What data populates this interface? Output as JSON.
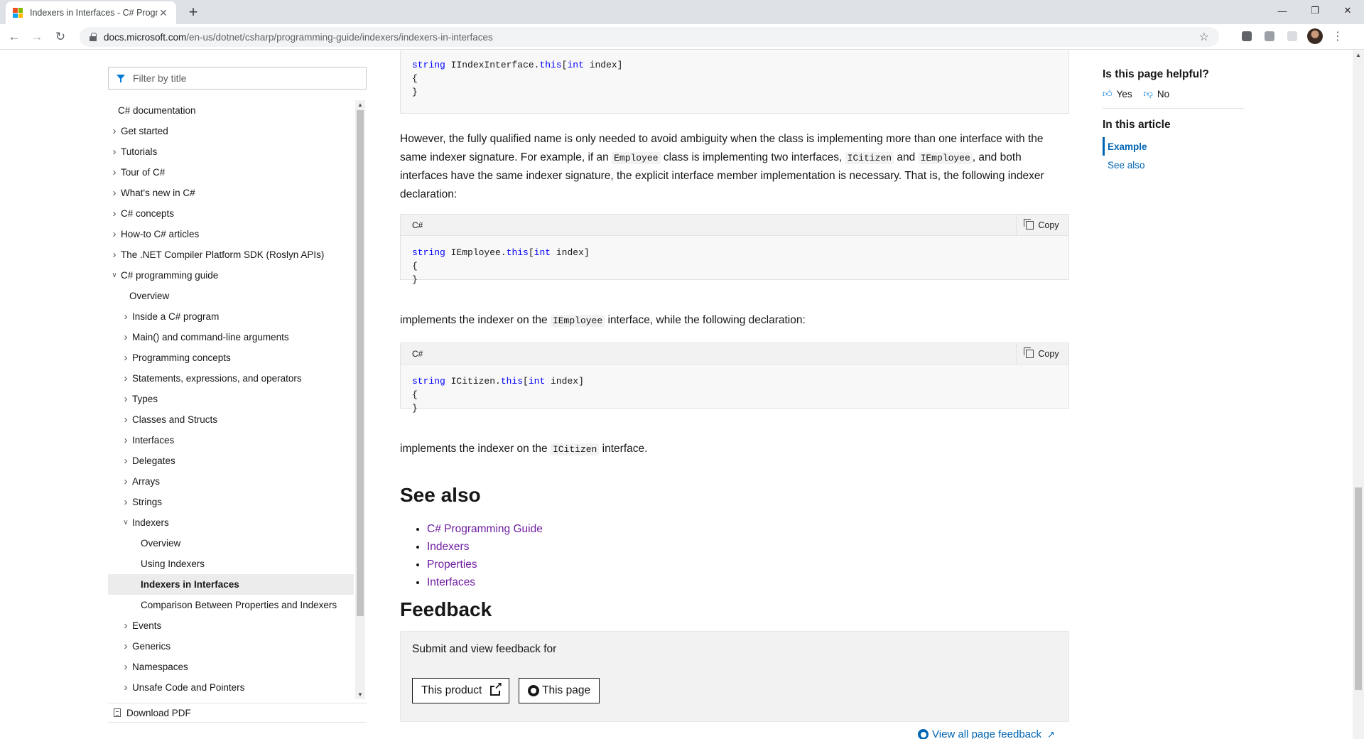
{
  "browser": {
    "tab_title": "Indexers in Interfaces - C# Progra",
    "url_host": "docs.microsoft.com",
    "url_path": "/en-us/dotnet/csharp/programming-guide/indexers/indexers-in-interfaces"
  },
  "toc": {
    "filter_placeholder": "Filter by title",
    "items": [
      {
        "label": "C# documentation",
        "level": 0,
        "chevron": "none"
      },
      {
        "label": "Get started",
        "level": 0,
        "chevron": "right"
      },
      {
        "label": "Tutorials",
        "level": 0,
        "chevron": "right"
      },
      {
        "label": "Tour of C#",
        "level": 0,
        "chevron": "right"
      },
      {
        "label": "What's new in C#",
        "level": 0,
        "chevron": "right"
      },
      {
        "label": "C# concepts",
        "level": 0,
        "chevron": "right"
      },
      {
        "label": "How-to C# articles",
        "level": 0,
        "chevron": "right"
      },
      {
        "label": "The .NET Compiler Platform SDK (Roslyn APIs)",
        "level": 0,
        "chevron": "right"
      },
      {
        "label": "C# programming guide",
        "level": 0,
        "chevron": "down"
      },
      {
        "label": "Overview",
        "level": 1,
        "chevron": "none"
      },
      {
        "label": "Inside a C# program",
        "level": 1,
        "chevron": "right"
      },
      {
        "label": "Main() and command-line arguments",
        "level": 1,
        "chevron": "right"
      },
      {
        "label": "Programming concepts",
        "level": 1,
        "chevron": "right"
      },
      {
        "label": "Statements, expressions, and operators",
        "level": 1,
        "chevron": "right"
      },
      {
        "label": "Types",
        "level": 1,
        "chevron": "right"
      },
      {
        "label": "Classes and Structs",
        "level": 1,
        "chevron": "right"
      },
      {
        "label": "Interfaces",
        "level": 1,
        "chevron": "right"
      },
      {
        "label": "Delegates",
        "level": 1,
        "chevron": "right"
      },
      {
        "label": "Arrays",
        "level": 1,
        "chevron": "right"
      },
      {
        "label": "Strings",
        "level": 1,
        "chevron": "right"
      },
      {
        "label": "Indexers",
        "level": 1,
        "chevron": "down"
      },
      {
        "label": "Overview",
        "level": 2,
        "chevron": "none"
      },
      {
        "label": "Using Indexers",
        "level": 2,
        "chevron": "none"
      },
      {
        "label": "Indexers in Interfaces",
        "level": 2,
        "chevron": "none",
        "active": true
      },
      {
        "label": "Comparison Between Properties and Indexers",
        "level": 2,
        "chevron": "none"
      },
      {
        "label": "Events",
        "level": 1,
        "chevron": "right"
      },
      {
        "label": "Generics",
        "level": 1,
        "chevron": "right"
      },
      {
        "label": "Namespaces",
        "level": 1,
        "chevron": "right"
      },
      {
        "label": "Unsafe Code and Pointers",
        "level": 1,
        "chevron": "right"
      }
    ],
    "download_pdf": "Download PDF"
  },
  "content": {
    "code1": {
      "type": "string",
      "name": " IIndexInterface.",
      "kw_this": "this",
      "bracket": "[",
      "kw_int": "int",
      "rest": " index]",
      "lines_after": "{\n}"
    },
    "para1": {
      "t1": "However, the fully qualified name is only needed to avoid ambiguity when the class is implementing more than one interface with the same indexer signature. For example, if an ",
      "c1": "Employee",
      "t2": " class is implementing two interfaces, ",
      "c2": "ICitizen",
      "t3": " and ",
      "c3": "IEmployee",
      "t4": ", and both interfaces have the same indexer signature, the explicit interface member implementation is necessary. That is, the following indexer declaration:"
    },
    "code2": {
      "lang": "C#",
      "copy": "Copy",
      "type": "string",
      "name": " IEmployee.",
      "kw_this": "this",
      "bracket": "[",
      "kw_int": "int",
      "rest": " index]",
      "lines_after": "{\n}"
    },
    "para2": {
      "t1": "implements the indexer on the ",
      "c1": "IEmployee",
      "t2": " interface, while the following declaration:"
    },
    "code3": {
      "lang": "C#",
      "copy": "Copy",
      "type": "string",
      "name": " ICitizen.",
      "kw_this": "this",
      "bracket": "[",
      "kw_int": "int",
      "rest": " index]",
      "lines_after": "{\n}"
    },
    "para3": {
      "t1": "implements the indexer on the ",
      "c1": "ICitizen",
      "t2": " interface."
    },
    "see_also_heading": "See also",
    "see_also_links": [
      "C# Programming Guide",
      "Indexers",
      "Properties",
      "Interfaces"
    ],
    "feedback_heading": "Feedback",
    "feedback_text": "Submit and view feedback for",
    "btn_product": "This product",
    "btn_page": "This page",
    "view_all": "View all page feedback"
  },
  "rail": {
    "helpful_title": "Is this page helpful?",
    "yes": "Yes",
    "no": "No",
    "in_this_article": "In this article",
    "links": [
      "Example",
      "See also"
    ]
  }
}
